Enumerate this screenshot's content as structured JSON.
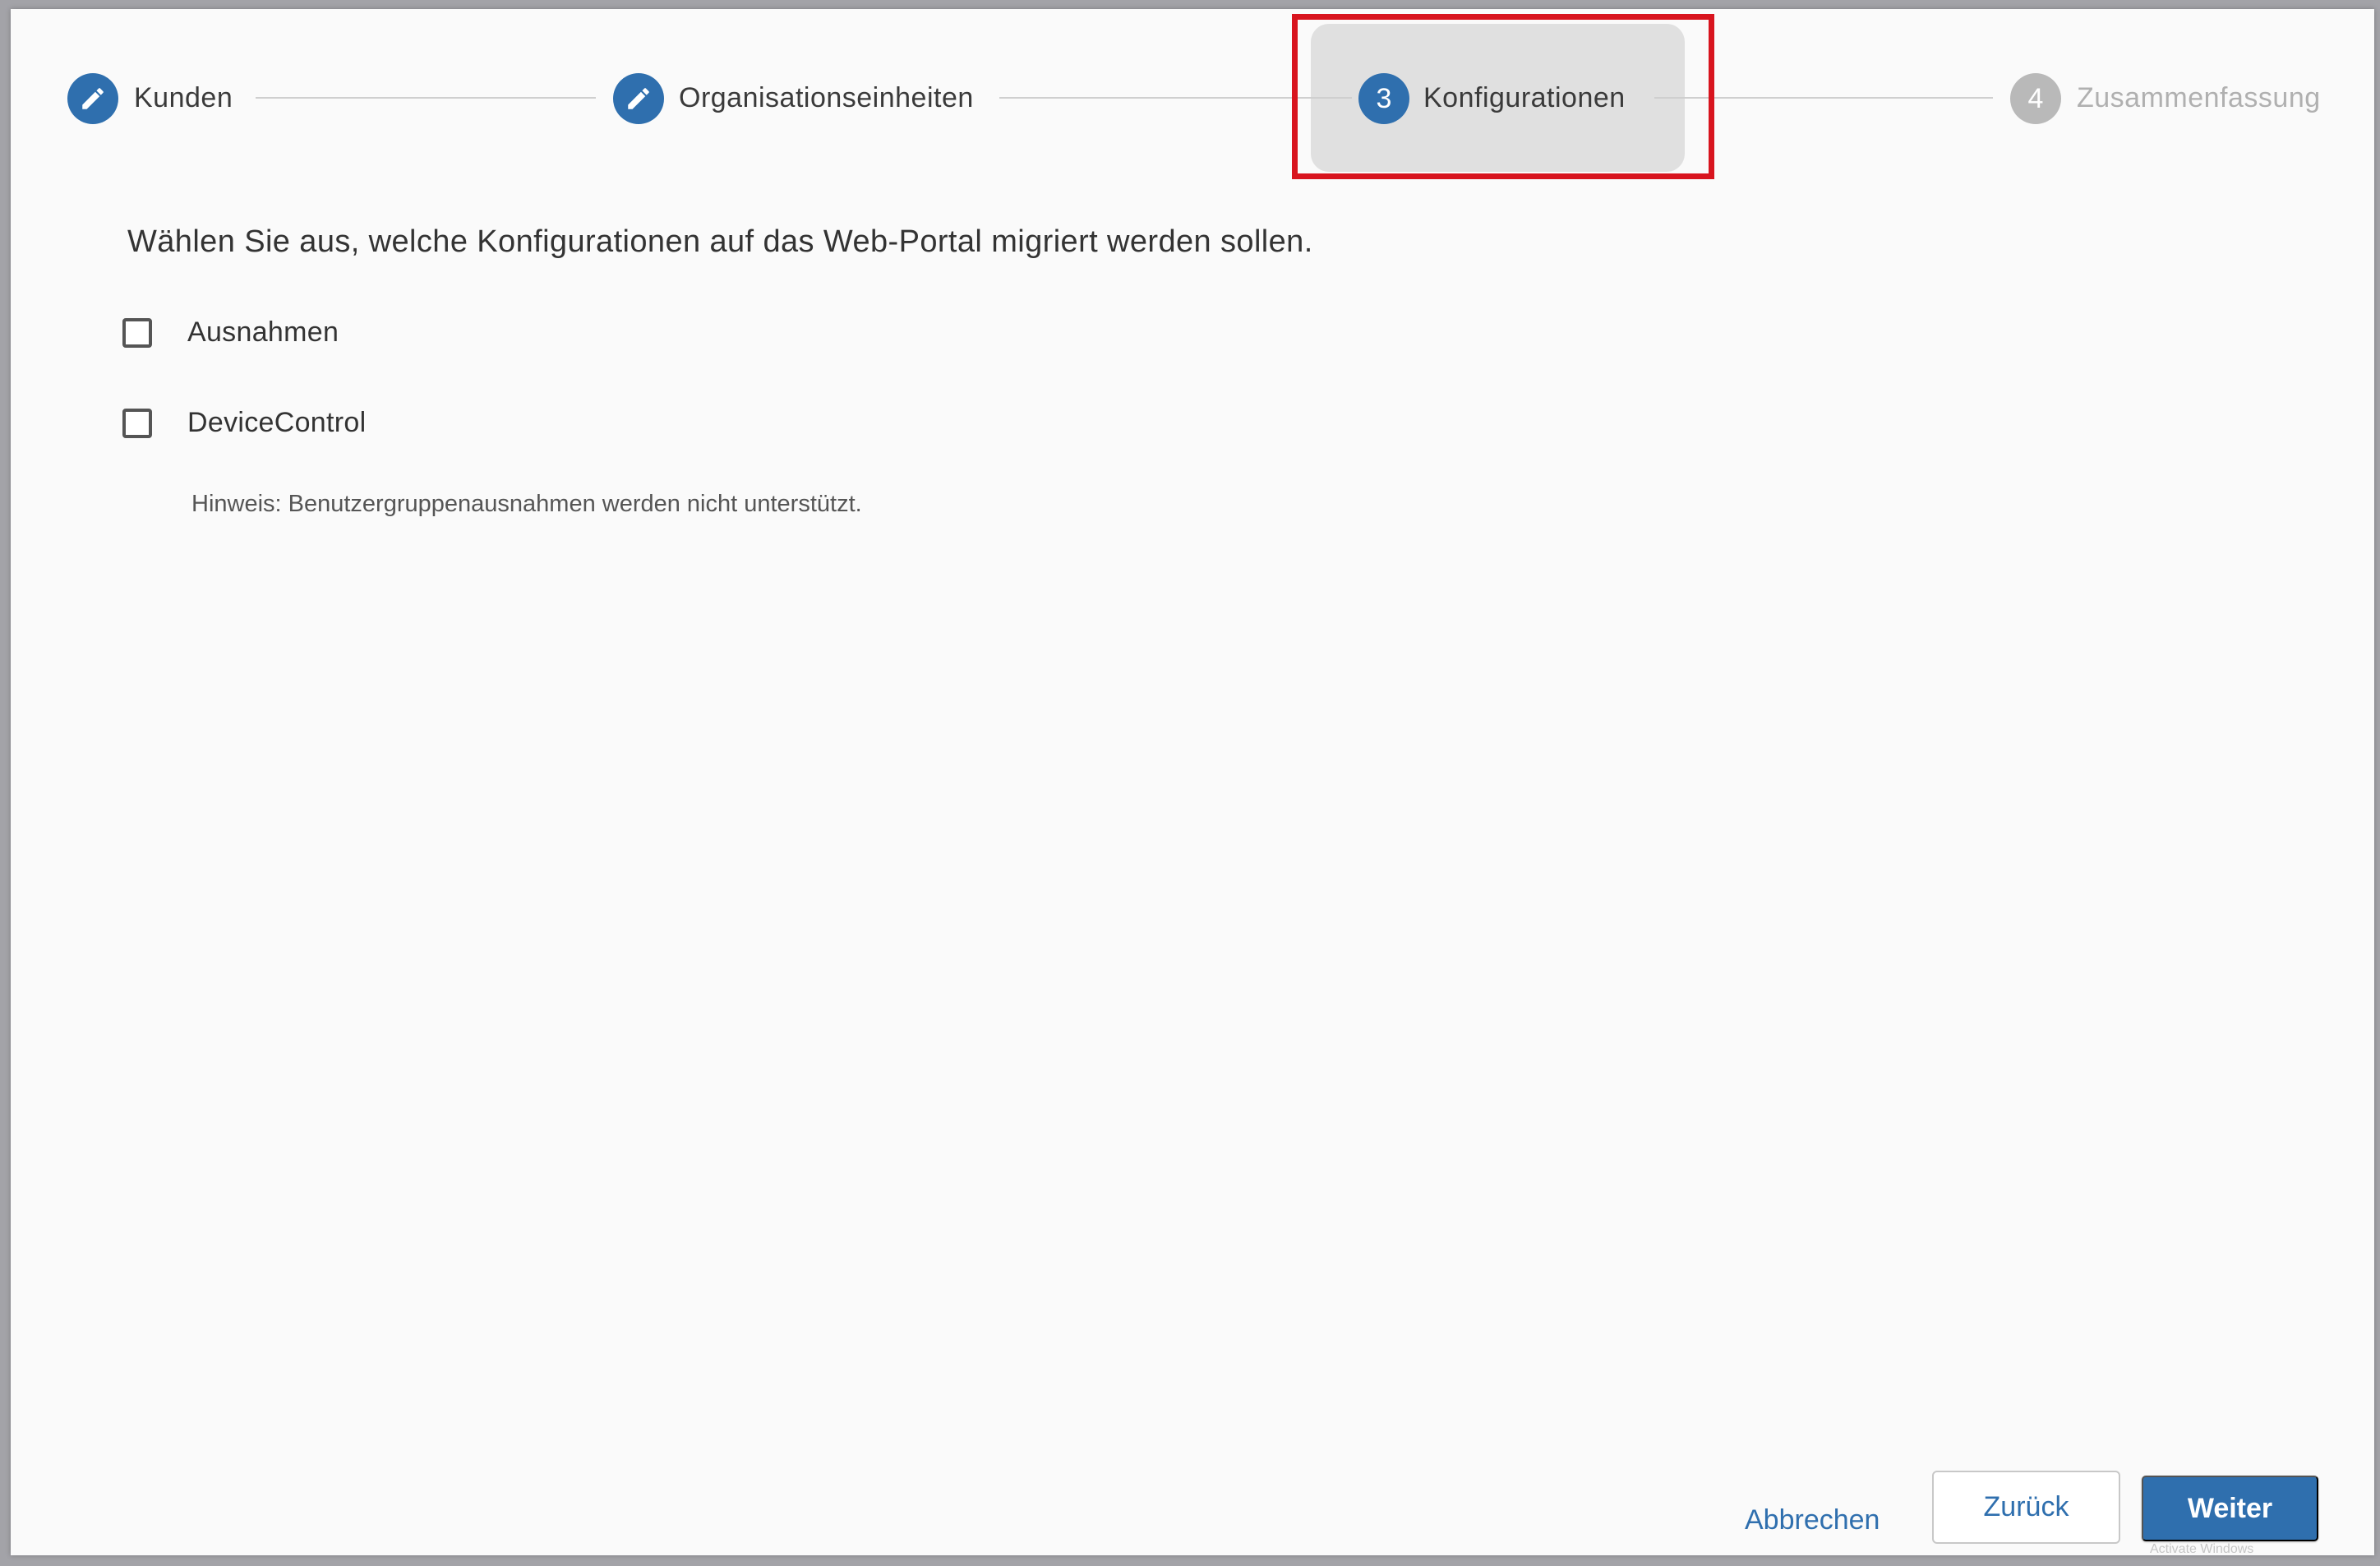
{
  "stepper": {
    "steps": [
      {
        "label": "Kunden",
        "marker": "",
        "state": "done",
        "icon": "pencil-icon"
      },
      {
        "label": "Organisationseinheiten",
        "marker": "",
        "state": "done",
        "icon": "pencil-icon"
      },
      {
        "label": "Konfigurationen",
        "marker": "3",
        "state": "active"
      },
      {
        "label": "Zusammenfassung",
        "marker": "4",
        "state": "pending"
      }
    ]
  },
  "main": {
    "instruction": "Wählen Sie aus, welche Konfigurationen auf das Web-Portal migriert werden sollen.",
    "options": [
      {
        "label": "Ausnahmen",
        "checked": false
      },
      {
        "label": "DeviceControl",
        "checked": false
      }
    ],
    "hint": "Hinweis: Benutzergruppenausnahmen werden nicht unterstützt."
  },
  "footer": {
    "cancel_label": "Abbrechen",
    "back_label": "Zurück",
    "next_label": "Weiter"
  },
  "watermark": "Activate Windows",
  "colors": {
    "accent": "#2f6fae",
    "highlight": "#d8141e",
    "pending": "#b9b9b9"
  }
}
